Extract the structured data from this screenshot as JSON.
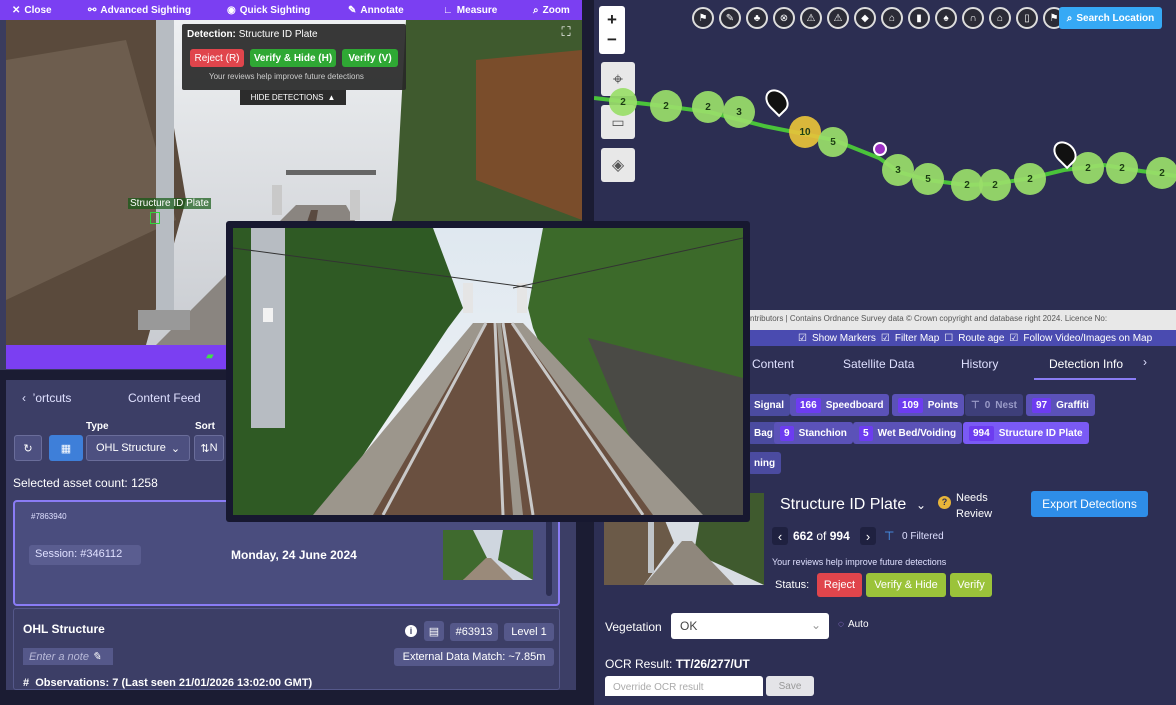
{
  "toolbar": {
    "close": "Close",
    "advanced_sighting": "Advanced Sighting",
    "quick_sighting": "Quick Sighting",
    "annotate": "Annotate",
    "measure": "Measure",
    "zoom": "Zoom"
  },
  "detection_popup": {
    "title_prefix": "Detection:",
    "title_value": "Structure ID Plate",
    "reject": "Reject (R)",
    "verify_hide": "Verify & Hide (H)",
    "verify": "Verify (V)",
    "hint": "Your reviews help improve future detections",
    "hide": "HIDE DETECTIONS"
  },
  "photo_label": "Structure ID Plate",
  "left_panel": {
    "tab_shortcuts": "’ortcuts",
    "tab_content_feed": "Content Feed",
    "type_label": "Type",
    "sort_label": "Sort",
    "type_value": "OHL Structure",
    "sort_value": "N",
    "selected_count": "Selected asset count: 1258",
    "card_id": "#7863940",
    "session": "Session: #346112",
    "date": "Monday, 24 June 2024",
    "ohl_title": "OHL Structure",
    "asset_id": "#63913",
    "level": "Level 1",
    "note_placeholder": "Enter a note",
    "external_match": "External Data Match: ~7.85m",
    "observations": "Observations: 7 (Last seen 21/01/2026 13:02:00 GMT)"
  },
  "map": {
    "search_location": "Search Location",
    "zoom_in": "+",
    "zoom_out": "−",
    "attribution": "ntributors | Contains Ordnance Survey data © Crown copyright and database right 2024. Licence No:",
    "node_values": [
      "2",
      "2",
      "2",
      "3",
      "10",
      "5",
      "3",
      "5",
      "2",
      "2",
      "2",
      "2",
      "2",
      "2"
    ]
  },
  "map_options": {
    "show_markers": "Show Markers",
    "filter_map": "Filter Map",
    "route_age": "Route age",
    "follow": "Follow Video/Images on Map"
  },
  "right_tabs": [
    "Content",
    "Satellite Data",
    "History",
    "Detection Info"
  ],
  "chips": [
    {
      "label": "Signal"
    },
    {
      "num": "166",
      "label": "Speedboard"
    },
    {
      "num": "109",
      "label": "Points"
    },
    {
      "num": "0",
      "label": "Nest"
    },
    {
      "num": "97",
      "label": "Graffiti"
    },
    {
      "label": "Bag"
    },
    {
      "num": "9",
      "label": "Stanchion"
    },
    {
      "num": "5",
      "label": "Wet Bed/Voiding"
    },
    {
      "num": "994",
      "label": "Structure ID Plate"
    },
    {
      "label": "ning"
    }
  ],
  "detection": {
    "title": "Structure ID Plate",
    "needs_review": "Needs Review",
    "export": "Export Detections",
    "current": "662",
    "of": "of",
    "total": "994",
    "filtered": "0 Filtered",
    "hint": "Your reviews help improve future detections",
    "status_label": "Status:",
    "reject": "Reject",
    "verify_hide": "Verify & Hide",
    "verify": "Verify",
    "vegetation_label": "Vegetation",
    "vegetation_value": "OK",
    "auto": "Auto",
    "ocr_label": "OCR Result:",
    "ocr_value": "TT/26/277/UT",
    "override_placeholder": "Override OCR result",
    "save": "Save"
  },
  "colors": {
    "accent": "#7b3ff2",
    "panel": "#3c3e66",
    "reject": "#e0454c",
    "verify": "#9bc33a",
    "export": "#2e8de8"
  }
}
